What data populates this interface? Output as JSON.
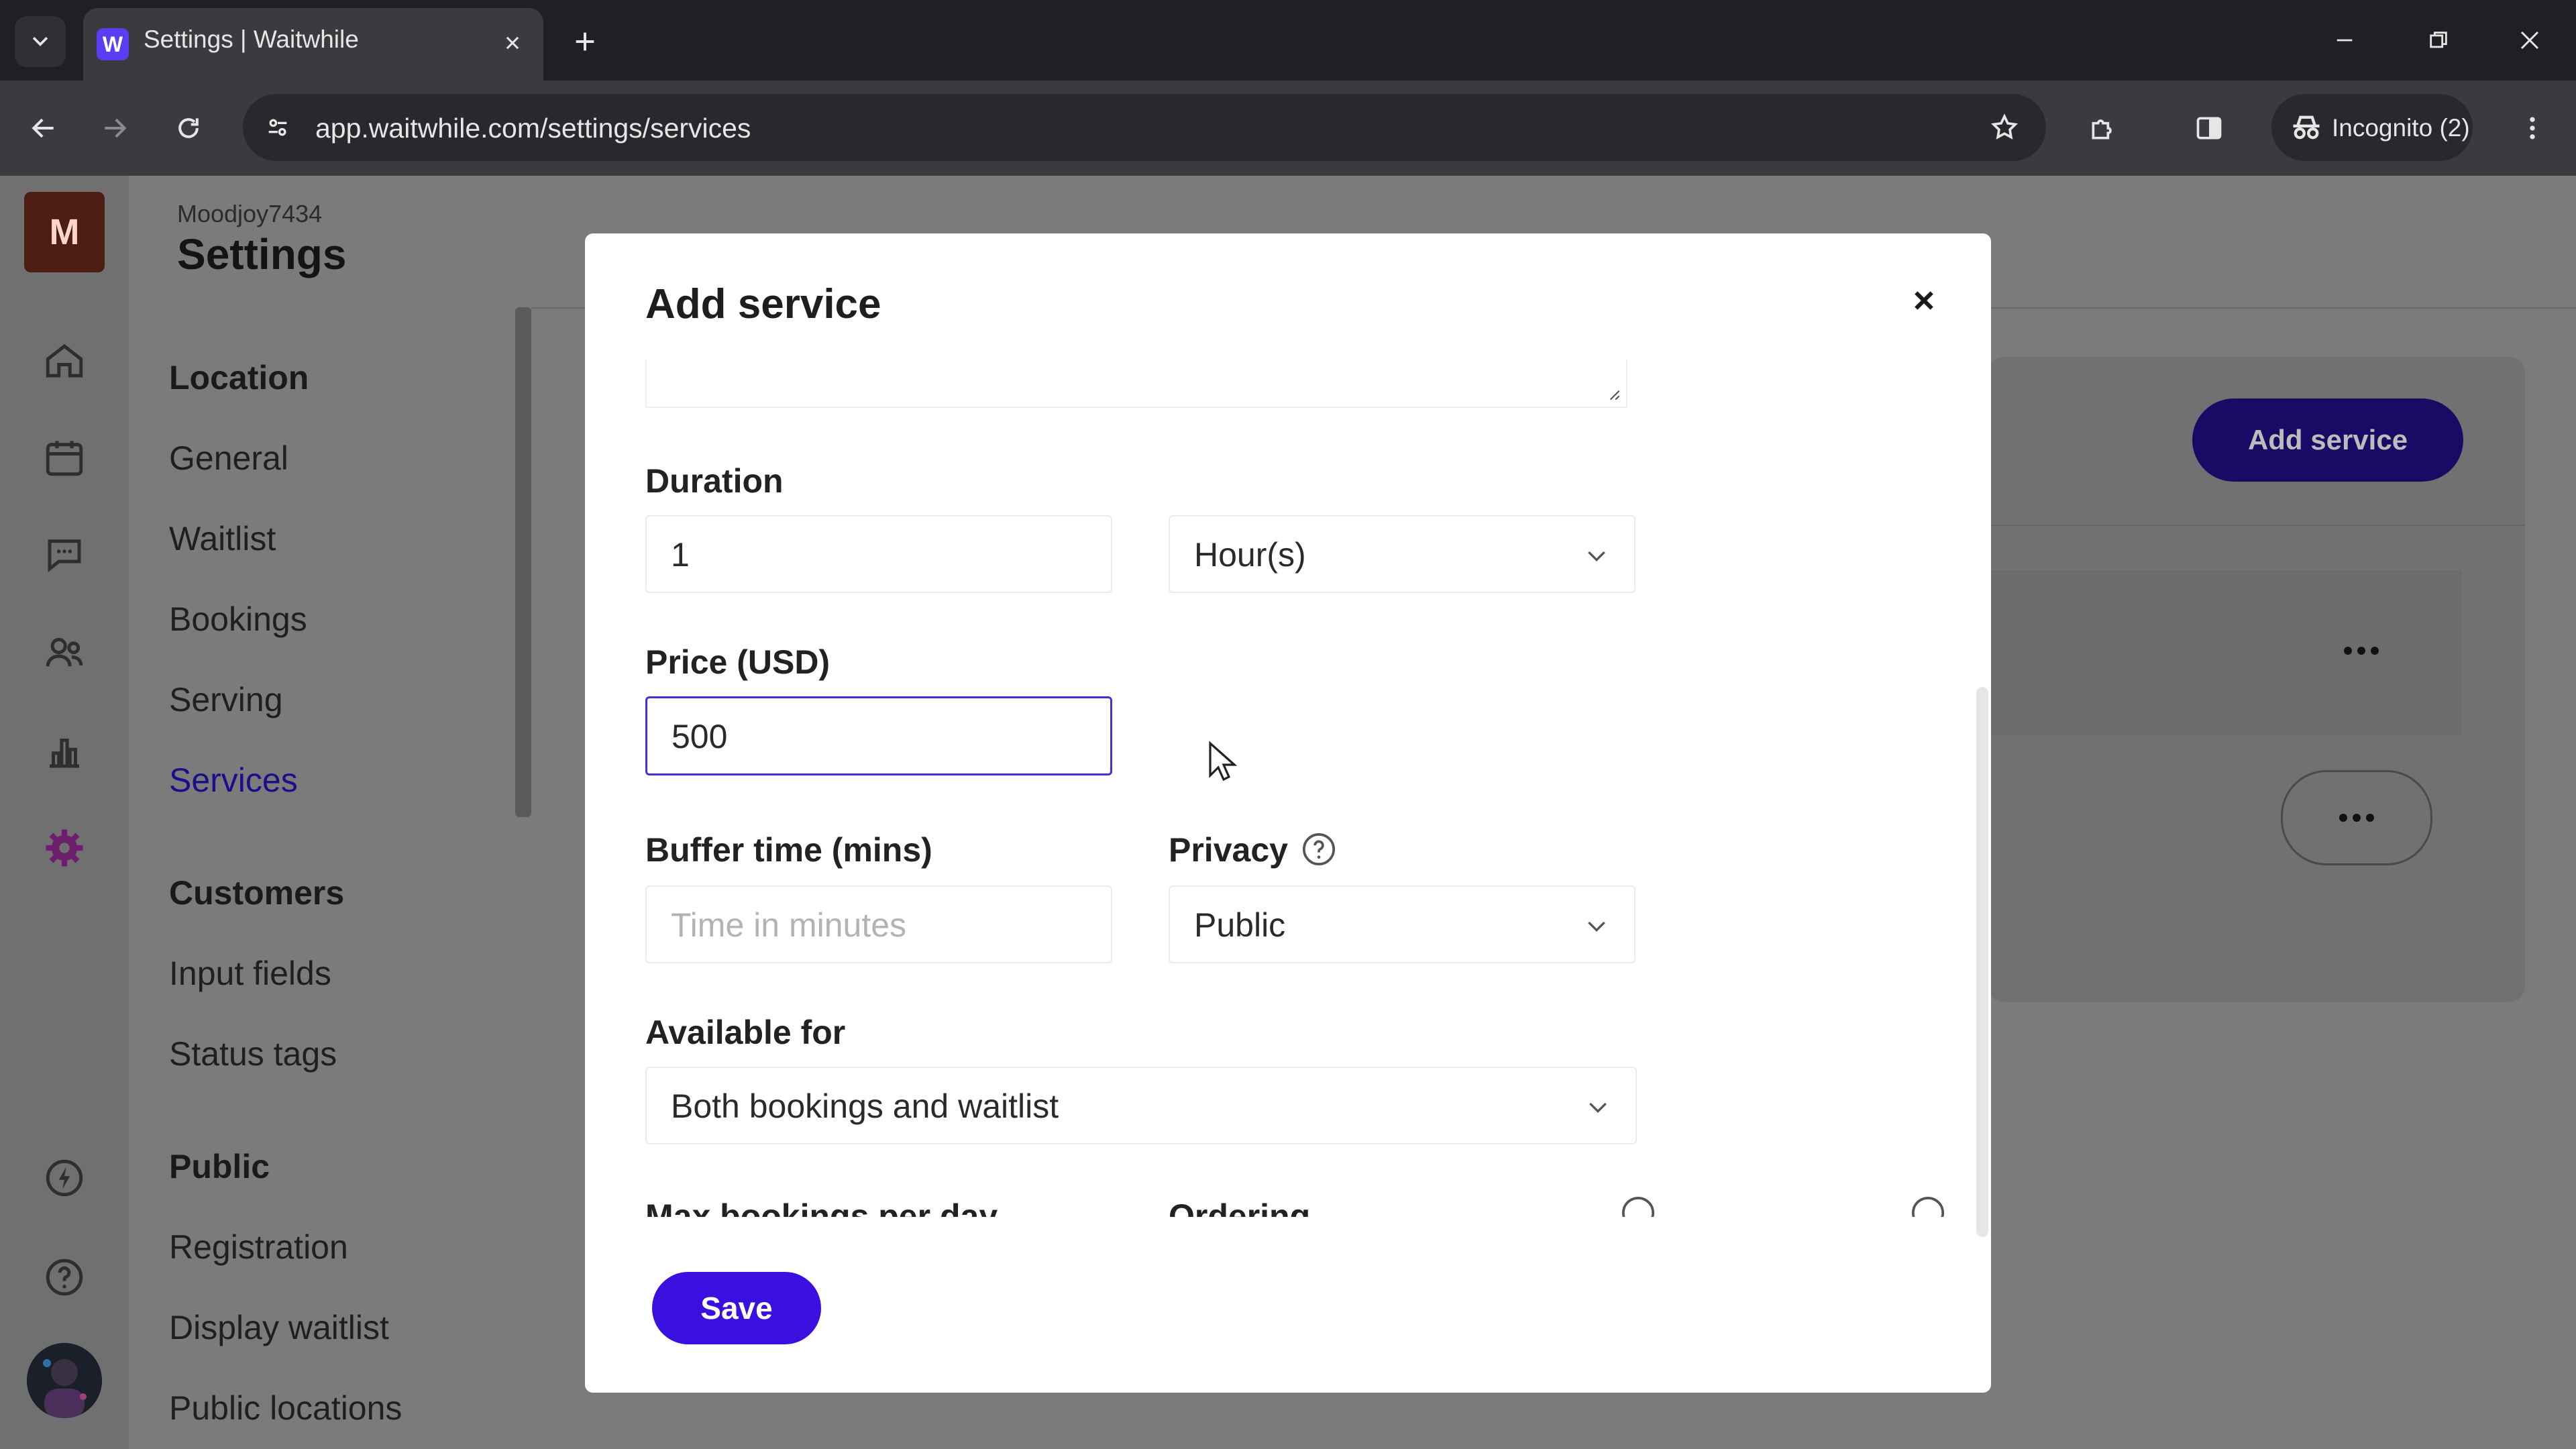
{
  "browser": {
    "tab_title": "Settings | Waitwhile",
    "favicon_letter": "W",
    "url": "app.waitwhile.com/settings/services",
    "incognito_label": "Incognito (2)"
  },
  "rail": {
    "avatar_letter": "M"
  },
  "header": {
    "workspace": "Moodjoy7434",
    "title": "Settings"
  },
  "sidebar": {
    "location_heading": "Location",
    "location_items": [
      "General",
      "Waitlist",
      "Bookings",
      "Serving",
      "Services"
    ],
    "active_item": "Services",
    "customers_heading": "Customers",
    "customers_items": [
      "Input fields",
      "Status tags"
    ],
    "public_heading": "Public",
    "public_items": [
      "Registration",
      "Display waitlist",
      "Public locations"
    ]
  },
  "background": {
    "add_service_button": "Add service"
  },
  "modal": {
    "title": "Add service",
    "duration": {
      "label": "Duration",
      "value": "1",
      "unit": "Hour(s)"
    },
    "price": {
      "label": "Price (USD)",
      "value": "500"
    },
    "buffer": {
      "label": "Buffer time (mins)",
      "placeholder": "Time in minutes"
    },
    "privacy": {
      "label": "Privacy",
      "value": "Public"
    },
    "available_for": {
      "label": "Available for",
      "value": "Both bookings and waitlist"
    },
    "max_bookings": {
      "label": "Max bookings per day"
    },
    "ordering": {
      "label": "Ordering"
    },
    "save_label": "Save"
  },
  "colors": {
    "accent": "#3a0fe0",
    "focus_border": "#4a2fd8",
    "active_nav": "#1b0e8a"
  }
}
